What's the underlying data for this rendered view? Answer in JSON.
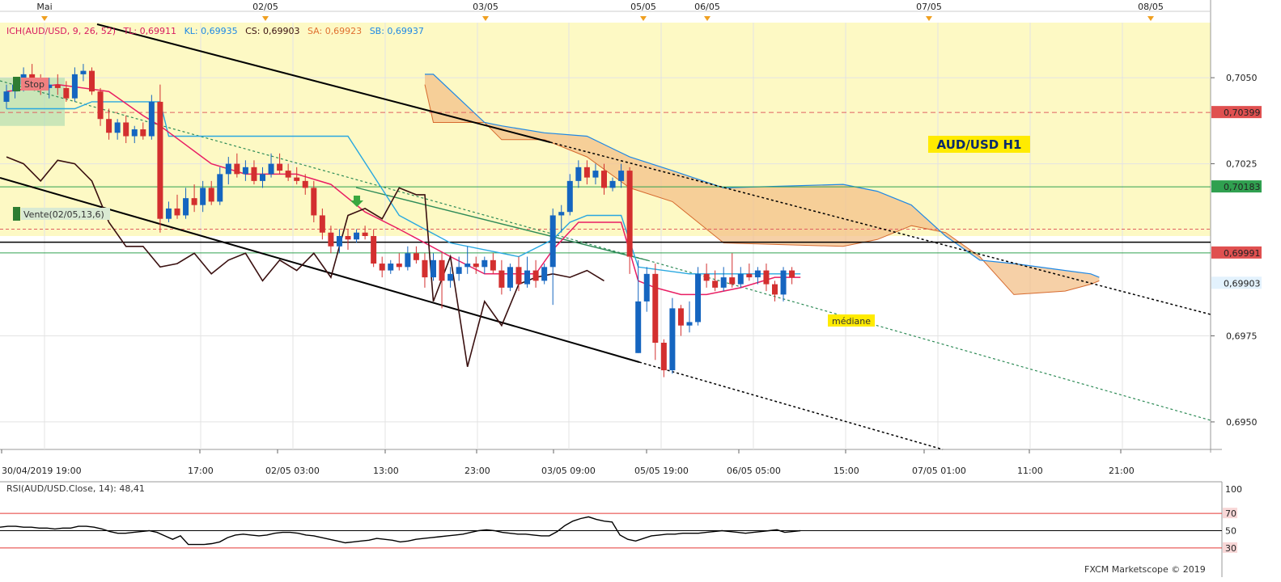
{
  "chart_data": {
    "type": "candlestick",
    "symbol": "AUD/USD",
    "timeframe": "H1",
    "title": "AUD/USD H1",
    "top_dates": [
      "Mai",
      "02/05",
      "03/05",
      "05/05",
      "06/05",
      "07/05",
      "08/05"
    ],
    "time_ticks": [
      "30/04/2019 19:00",
      "17:00",
      "02/05 03:00",
      "13:00",
      "23:00",
      "03/05 09:00",
      "05/05 19:00",
      "06/05 05:00",
      "15:00",
      "07/05 01:00",
      "11:00",
      "21:00"
    ],
    "y_ticks": [
      "0,7050",
      "0,7025",
      "0,6975",
      "0,6950"
    ],
    "ylim": [
      0.6942,
      0.7066
    ],
    "indicator_legend": {
      "name": "ICH(AUD/USD, 9, 26, 52)",
      "tl": "TL: 0,69911",
      "kl": "KL: 0,69935",
      "cs": "CS: 0,69903",
      "sa": "SA: 0,69923",
      "sb": "SB: 0,69937"
    },
    "price_labels": [
      {
        "text": "0,70399",
        "value": 0.70399,
        "color": "#e05050"
      },
      {
        "text": "0,70183",
        "value": 0.70183,
        "color": "#30a050"
      },
      {
        "text": "0,69991",
        "value": 0.69991,
        "color": "#e05050"
      },
      {
        "text": "0,69903",
        "value": 0.69903,
        "color": "#1e88e5"
      }
    ],
    "annotations": {
      "stop": "Stop",
      "sell": "Vente(02/05,13,6)",
      "median": "médiane"
    },
    "candles": [
      [
        0.7043,
        0.7048,
        0.7041,
        0.7046
      ],
      [
        0.7046,
        0.705,
        0.7044,
        0.7048
      ],
      [
        0.7048,
        0.7053,
        0.7046,
        0.7051
      ],
      [
        0.7051,
        0.7054,
        0.7047,
        0.7049
      ],
      [
        0.7049,
        0.7051,
        0.7045,
        0.7047
      ],
      [
        0.7047,
        0.705,
        0.7044,
        0.7048
      ],
      [
        0.7048,
        0.7051,
        0.7045,
        0.7047
      ],
      [
        0.7047,
        0.7049,
        0.7043,
        0.7044
      ],
      [
        0.7044,
        0.7053,
        0.7043,
        0.7051
      ],
      [
        0.7051,
        0.7054,
        0.7049,
        0.7052
      ],
      [
        0.7052,
        0.7053,
        0.7045,
        0.7046
      ],
      [
        0.7046,
        0.7047,
        0.7036,
        0.7038
      ],
      [
        0.7038,
        0.7041,
        0.7032,
        0.7034
      ],
      [
        0.7034,
        0.7038,
        0.7032,
        0.7037
      ],
      [
        0.7037,
        0.7039,
        0.7031,
        0.7033
      ],
      [
        0.7033,
        0.7036,
        0.7031,
        0.7035
      ],
      [
        0.7035,
        0.7037,
        0.7032,
        0.7033
      ],
      [
        0.7033,
        0.7045,
        0.7032,
        0.7043
      ],
      [
        0.7043,
        0.7048,
        0.7005,
        0.7009
      ],
      [
        0.7009,
        0.7014,
        0.7008,
        0.7012
      ],
      [
        0.7012,
        0.7016,
        0.7009,
        0.701
      ],
      [
        0.701,
        0.7018,
        0.7009,
        0.7015
      ],
      [
        0.7015,
        0.7019,
        0.7011,
        0.7013
      ],
      [
        0.7013,
        0.702,
        0.7011,
        0.7018
      ],
      [
        0.7018,
        0.702,
        0.7013,
        0.7014
      ],
      [
        0.7014,
        0.7024,
        0.7013,
        0.7022
      ],
      [
        0.7022,
        0.7027,
        0.7019,
        0.7025
      ],
      [
        0.7025,
        0.7028,
        0.7021,
        0.7022
      ],
      [
        0.7022,
        0.7026,
        0.702,
        0.7024
      ],
      [
        0.7024,
        0.7026,
        0.7019,
        0.702
      ],
      [
        0.702,
        0.7024,
        0.7018,
        0.7022
      ],
      [
        0.7022,
        0.7028,
        0.7021,
        0.7025
      ],
      [
        0.7025,
        0.7028,
        0.7022,
        0.7023
      ],
      [
        0.7023,
        0.7025,
        0.702,
        0.7021
      ],
      [
        0.7021,
        0.7024,
        0.7019,
        0.702
      ],
      [
        0.702,
        0.7022,
        0.7016,
        0.7018
      ],
      [
        0.7018,
        0.702,
        0.7008,
        0.701
      ],
      [
        0.701,
        0.7012,
        0.7003,
        0.7005
      ],
      [
        0.7005,
        0.7007,
        0.6999,
        0.7001
      ],
      [
        0.7001,
        0.7006,
        0.6999,
        0.7004
      ],
      [
        0.7004,
        0.7006,
        0.7,
        0.7003
      ],
      [
        0.7003,
        0.7006,
        0.7002,
        0.7005
      ],
      [
        0.7005,
        0.7007,
        0.7003,
        0.7004
      ],
      [
        0.7004,
        0.7006,
        0.6995,
        0.6996
      ],
      [
        0.6996,
        0.6998,
        0.6992,
        0.6994
      ],
      [
        0.6994,
        0.6997,
        0.6993,
        0.6996
      ],
      [
        0.6996,
        0.6999,
        0.6994,
        0.6995
      ],
      [
        0.6995,
        0.7001,
        0.6994,
        0.6999
      ],
      [
        0.6999,
        0.7001,
        0.6996,
        0.6997
      ],
      [
        0.6997,
        0.6999,
        0.6989,
        0.6992
      ],
      [
        0.6992,
        0.6999,
        0.6991,
        0.6997
      ],
      [
        0.6997,
        0.6999,
        0.6983,
        0.6991
      ],
      [
        0.6991,
        0.6995,
        0.6989,
        0.6993
      ],
      [
        0.6993,
        0.6998,
        0.6991,
        0.6995
      ],
      [
        0.6995,
        0.7001,
        0.6993,
        0.6996
      ],
      [
        0.6996,
        0.6998,
        0.6993,
        0.6995
      ],
      [
        0.6995,
        0.6998,
        0.6993,
        0.6997
      ],
      [
        0.6997,
        0.6999,
        0.6993,
        0.6994
      ],
      [
        0.6994,
        0.6997,
        0.6987,
        0.6989
      ],
      [
        0.6989,
        0.6996,
        0.6988,
        0.6995
      ],
      [
        0.6995,
        0.6998,
        0.6988,
        0.699
      ],
      [
        0.699,
        0.6998,
        0.6989,
        0.6994
      ],
      [
        0.6994,
        0.6997,
        0.6989,
        0.6991
      ],
      [
        0.6991,
        0.6996,
        0.699,
        0.6995
      ],
      [
        0.6995,
        0.7012,
        0.6984,
        0.701
      ],
      [
        0.701,
        0.7013,
        0.7005,
        0.7011
      ],
      [
        0.7011,
        0.7022,
        0.701,
        0.702
      ],
      [
        0.702,
        0.7026,
        0.7018,
        0.7024
      ],
      [
        0.7024,
        0.7026,
        0.7019,
        0.7021
      ],
      [
        0.7021,
        0.7025,
        0.7019,
        0.7023
      ],
      [
        0.7023,
        0.7025,
        0.7016,
        0.7018
      ],
      [
        0.7018,
        0.7021,
        0.7017,
        0.702
      ],
      [
        0.702,
        0.7025,
        0.7018,
        0.7023
      ],
      [
        0.7023,
        0.7024,
        0.6993,
        0.6998
      ],
      [
        0.697,
        0.6997,
        0.697,
        0.6985
      ],
      [
        0.6985,
        0.6995,
        0.6982,
        0.6993
      ],
      [
        0.6993,
        0.6996,
        0.6968,
        0.6973
      ],
      [
        0.6973,
        0.6974,
        0.6963,
        0.6965
      ],
      [
        0.6965,
        0.6986,
        0.6964,
        0.6983
      ],
      [
        0.6983,
        0.6984,
        0.6975,
        0.6978
      ],
      [
        0.6978,
        0.6985,
        0.6976,
        0.6979
      ],
      [
        0.6979,
        0.6995,
        0.6978,
        0.6993
      ],
      [
        0.6993,
        0.6996,
        0.6989,
        0.6991
      ],
      [
        0.6991,
        0.6994,
        0.6988,
        0.6989
      ],
      [
        0.6989,
        0.6995,
        0.6988,
        0.6992
      ],
      [
        0.6992,
        0.6999,
        0.6989,
        0.699
      ],
      [
        0.699,
        0.6995,
        0.6989,
        0.6993
      ],
      [
        0.6993,
        0.6996,
        0.6991,
        0.6992
      ],
      [
        0.6992,
        0.6995,
        0.699,
        0.6994
      ],
      [
        0.6994,
        0.6996,
        0.6988,
        0.699
      ],
      [
        0.699,
        0.6991,
        0.6985,
        0.6987
      ],
      [
        0.6987,
        0.6995,
        0.6985,
        0.6994
      ],
      [
        0.6994,
        0.6995,
        0.699,
        0.6992
      ]
    ],
    "tenkan_line": [
      [
        0,
        0.7046
      ],
      [
        6,
        0.7048
      ],
      [
        12,
        0.7046
      ],
      [
        16,
        0.7039
      ],
      [
        18,
        0.7036
      ],
      [
        24,
        0.7025
      ],
      [
        28,
        0.7022
      ],
      [
        34,
        0.7022
      ],
      [
        38,
        0.7019
      ],
      [
        42,
        0.7011
      ],
      [
        46,
        0.7006
      ],
      [
        52,
        0.6998
      ],
      [
        56,
        0.6993
      ],
      [
        62,
        0.6993
      ],
      [
        64,
        0.7
      ],
      [
        67,
        0.7008
      ],
      [
        72,
        0.7008
      ],
      [
        74,
        0.6991
      ],
      [
        76,
        0.6989
      ],
      [
        79,
        0.6987
      ],
      [
        82,
        0.6987
      ],
      [
        86,
        0.6989
      ],
      [
        90,
        0.6992
      ],
      [
        93,
        0.6992
      ]
    ],
    "kijun_line": [
      [
        0,
        0.7041
      ],
      [
        8,
        0.7041
      ],
      [
        10,
        0.7043
      ],
      [
        18,
        0.7043
      ],
      [
        19,
        0.7033
      ],
      [
        40,
        0.7033
      ],
      [
        46,
        0.701
      ],
      [
        52,
        0.7002
      ],
      [
        60,
        0.6998
      ],
      [
        64,
        0.7003
      ],
      [
        66,
        0.7008
      ],
      [
        68,
        0.701
      ],
      [
        72,
        0.701
      ],
      [
        74,
        0.6995
      ],
      [
        80,
        0.6993
      ],
      [
        93,
        0.6993
      ]
    ],
    "senkou_a": [
      [
        49,
        0.7048
      ],
      [
        50,
        0.7037
      ],
      [
        56,
        0.7037
      ],
      [
        58,
        0.7032
      ],
      [
        63,
        0.7032
      ],
      [
        68,
        0.7027
      ],
      [
        73,
        0.7018
      ],
      [
        78,
        0.7014
      ],
      [
        84,
        0.7002
      ],
      [
        98,
        0.7001
      ],
      [
        102,
        0.7003
      ],
      [
        106,
        0.7007
      ],
      [
        110,
        0.7005
      ],
      [
        114,
        0.6998
      ],
      [
        118,
        0.6987
      ],
      [
        124,
        0.6988
      ],
      [
        127,
        0.699
      ],
      [
        128,
        0.6991
      ]
    ],
    "senkou_b": [
      [
        49,
        0.7051
      ],
      [
        50,
        0.7051
      ],
      [
        56,
        0.7037
      ],
      [
        58,
        0.7036
      ],
      [
        63,
        0.7034
      ],
      [
        68,
        0.7033
      ],
      [
        73,
        0.7027
      ],
      [
        78,
        0.7023
      ],
      [
        84,
        0.7018
      ],
      [
        98,
        0.7019
      ],
      [
        102,
        0.7017
      ],
      [
        106,
        0.7013
      ],
      [
        110,
        0.7004
      ],
      [
        114,
        0.6997
      ],
      [
        118,
        0.6996
      ],
      [
        124,
        0.6994
      ],
      [
        127,
        0.6993
      ],
      [
        128,
        0.6992
      ]
    ],
    "chikou_span": [
      [
        0,
        0.7027
      ],
      [
        2,
        0.7025
      ],
      [
        4,
        0.702
      ],
      [
        6,
        0.7026
      ],
      [
        8,
        0.7025
      ],
      [
        10,
        0.702
      ],
      [
        12,
        0.7008
      ],
      [
        14,
        0.7001
      ],
      [
        16,
        0.7001
      ],
      [
        18,
        0.6995
      ],
      [
        20,
        0.6996
      ],
      [
        22,
        0.6999
      ],
      [
        24,
        0.6993
      ],
      [
        26,
        0.6997
      ],
      [
        28,
        0.6999
      ],
      [
        30,
        0.6991
      ],
      [
        32,
        0.6997
      ],
      [
        34,
        0.6994
      ],
      [
        36,
        0.6999
      ],
      [
        38,
        0.6992
      ],
      [
        40,
        0.701
      ],
      [
        42,
        0.7012
      ],
      [
        44,
        0.7009
      ],
      [
        46,
        0.7018
      ],
      [
        48,
        0.7016
      ],
      [
        49,
        0.7016
      ],
      [
        50,
        0.6985
      ],
      [
        52,
        0.6998
      ],
      [
        54,
        0.6966
      ],
      [
        56,
        0.6985
      ],
      [
        58,
        0.6978
      ],
      [
        60,
        0.699
      ],
      [
        62,
        0.6992
      ],
      [
        64,
        0.6993
      ],
      [
        66,
        0.6992
      ],
      [
        68,
        0.6994
      ],
      [
        70,
        0.6991
      ]
    ],
    "rsi": {
      "label": "RSI(AUD/USD.Close, 14): 48,41",
      "ticks": [
        "100",
        "70",
        "50",
        "30"
      ],
      "levels": [
        30,
        70
      ],
      "values": [
        54,
        55,
        55,
        54,
        54,
        53,
        53,
        52,
        53,
        53,
        55,
        55,
        54,
        52,
        49,
        47,
        47,
        48,
        49,
        50,
        48,
        44,
        40,
        44,
        34,
        34,
        34,
        35,
        37,
        42,
        45,
        46,
        45,
        44,
        45,
        47,
        48,
        48,
        47,
        45,
        44,
        42,
        40,
        38,
        36,
        37,
        38,
        39,
        41,
        40,
        39,
        37,
        38,
        40,
        41,
        42,
        43,
        44,
        45,
        46,
        48,
        50,
        51,
        50,
        48,
        47,
        46,
        46,
        45,
        44,
        44,
        49,
        56,
        61,
        64,
        66,
        63,
        61,
        60,
        45,
        40,
        38,
        41,
        44,
        45,
        46,
        46,
        47,
        47,
        47,
        48,
        49,
        50,
        49,
        48,
        47,
        48,
        49,
        50,
        51,
        48,
        49,
        50
      ]
    },
    "footer": "FXCM Marketscope © 2019"
  }
}
